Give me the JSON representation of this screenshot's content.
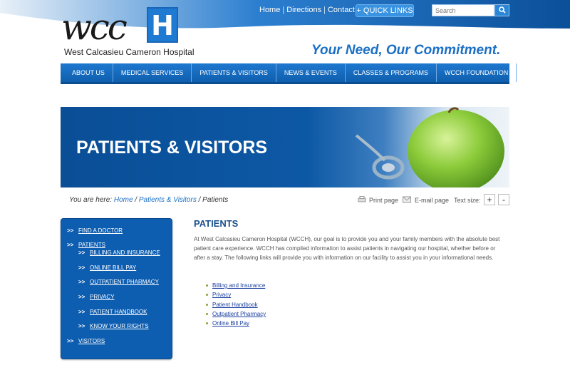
{
  "header": {
    "logo_letters": "wcc",
    "logo_h": "H",
    "hospital_name": "West Calcasieu Cameron Hospital",
    "tagline": "Your Need, Our Commitment.",
    "top_links": [
      "Home",
      "Directions",
      "Contact Us"
    ],
    "quick_links_label": "+ QUICK LINKS",
    "search_placeholder": "Search"
  },
  "nav": {
    "items": [
      "ABOUT US",
      "MEDICAL SERVICES",
      "PATIENTS & VISITORS",
      "NEWS & EVENTS",
      "CLASSES & PROGRAMS",
      "WCCH FOUNDATION"
    ]
  },
  "banner": {
    "title": "PATIENTS & VISITORS"
  },
  "breadcrumb": {
    "prefix": "You are here:",
    "home": "Home",
    "section": "Patients & Visitors",
    "current": "Patients",
    "sep": "/"
  },
  "tools": {
    "print": "Print page",
    "email": "E-mail page",
    "text_size": "Text size:",
    "plus": "+",
    "minus": "-"
  },
  "sidebar": {
    "arrow": ">>",
    "find_doctor": "FIND A DOCTOR",
    "patients": "PATIENTS",
    "sub_items": [
      "BILLING AND INSURANCE",
      "ONLINE BILL PAY",
      "OUTPATIENT PHARMACY",
      "PRIVACY",
      "PATIENT HANDBOOK",
      "KNOW YOUR RIGHTS"
    ],
    "visitors": "VISITORS"
  },
  "content": {
    "title": "PATIENTS",
    "paragraph": "At West Calcasieu Cameron Hospital (WCCH), our goal is to provide you and your family members with the absolute best patient care experience. WCCH has compiled information to assist patients in navigating our hospital, whether before or after a stay. The following links will provide you with information on our facility to assist you in your informational needs.",
    "links": [
      "Billing and Insurance",
      "Privacy",
      "Patient Handbook",
      "Outpatient Pharmacy",
      "Online Bill Pay"
    ]
  },
  "colors": {
    "primary_blue": "#0d5db0",
    "tagline_blue": "#1a6fc4",
    "bullet_green": "#8aa034"
  }
}
